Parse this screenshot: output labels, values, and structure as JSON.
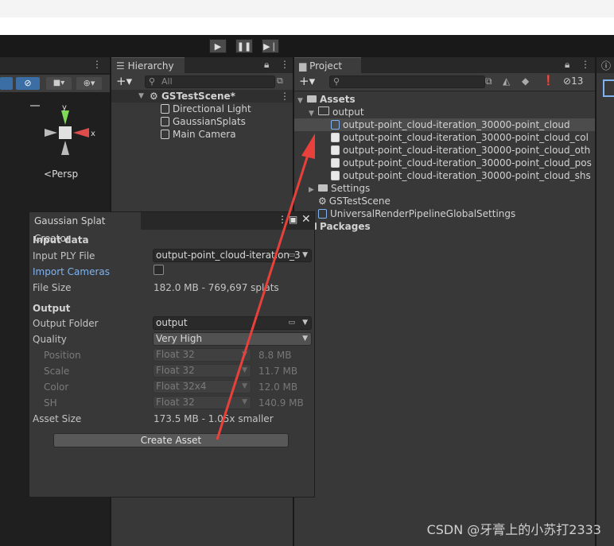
{
  "hierarchy": {
    "tab": "Hierarchy",
    "search_placeholder": "All",
    "scene": "GSTestScene*",
    "items": [
      "Directional Light",
      "GaussianSplats",
      "Main Camera"
    ]
  },
  "project": {
    "tab": "Project",
    "hidden_count": "13",
    "assets_label": "Assets",
    "output_folder": "output",
    "files": [
      "output-point_cloud-iteration_30000-point_cloud",
      "output-point_cloud-iteration_30000-point_cloud_col",
      "output-point_cloud-iteration_30000-point_cloud_oth",
      "output-point_cloud-iteration_30000-point_cloud_pos",
      "output-point_cloud-iteration_30000-point_cloud_shs"
    ],
    "settings": "Settings",
    "scene": "GSTestScene",
    "urp": "UniversalRenderPipelineGlobalSettings",
    "packages": "Packages"
  },
  "scene_view": {
    "persp": "Persp",
    "axis_y": "y",
    "axis_x": "x"
  },
  "creator": {
    "title": "Gaussian Splat Creator",
    "input_header": "Input data",
    "input_ply_label": "Input PLY File",
    "input_ply_value": "output-point_cloud-iteration_3",
    "import_cameras_label": "Import Cameras",
    "file_size_label": "File Size",
    "file_size_value": "182.0 MB - 769,697 splats",
    "output_header": "Output",
    "output_folder_label": "Output Folder",
    "output_folder_value": "output",
    "quality_label": "Quality",
    "quality_value": "Very High",
    "position_label": "Position",
    "position_value": "Float 32",
    "position_size": "8.8 MB",
    "scale_label": "Scale",
    "scale_value": "Float 32",
    "scale_size": "11.7 MB",
    "color_label": "Color",
    "color_value": "Float 32x4",
    "color_size": "12.0 MB",
    "sh_label": "SH",
    "sh_value": "Float 32",
    "sh_size": "140.9 MB",
    "asset_size_label": "Asset Size",
    "asset_size_value": "173.5 MB - 1.05x smaller",
    "create_button": "Create Asset"
  },
  "watermark": "CSDN @牙膏上的小苏打2333",
  "colors": {
    "arrow": "#e8403a",
    "accent_blue": "#7fb3f0",
    "panel": "#383838"
  }
}
